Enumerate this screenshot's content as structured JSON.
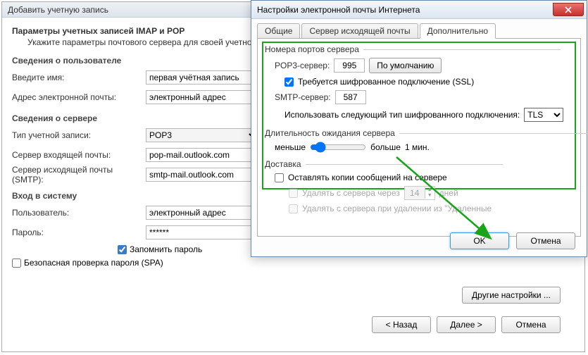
{
  "back": {
    "title": "Добавить учетную запись",
    "section_title": "Параметры учетных записей IMAP и POP",
    "section_desc": "Укажите параметры почтового сервера для своей учетно",
    "user_group": "Сведения о пользователе",
    "name_label": "Введите имя:",
    "name_value": "первая учётная запись",
    "email_label": "Адрес электронной почты:",
    "email_value": "электронный адрес",
    "server_group": "Сведения о сервере",
    "acct_type_label": "Тип учетной записи:",
    "acct_type_value": "POP3",
    "incoming_label": "Сервер входящей почты:",
    "incoming_value": "pop-mail.outlook.com",
    "outgoing_label": "Сервер исходящей почты (SMTP):",
    "outgoing_value": "smtp-mail.outlook.com",
    "login_group": "Вход в систему",
    "user_label": "Пользователь:",
    "user_value": "электронный адрес",
    "pass_label": "Пароль:",
    "pass_value": "******",
    "remember_label": "Запомнить пароль",
    "spa_label": "Безопасная проверка пароля (SPA)",
    "more_settings": "Другие настройки ...",
    "back_btn": "< Назад",
    "next_btn": "Далее >",
    "cancel_btn": "Отмена"
  },
  "front": {
    "title": "Настройки электронной почты Интернета",
    "tabs": {
      "general": "Общие",
      "outgoing": "Сервер исходящей почты",
      "advanced": "Дополнительно"
    },
    "ports_legend": "Номера портов сервера",
    "pop3_label": "POP3-сервер:",
    "pop3_value": "995",
    "default_btn": "По умолчанию",
    "ssl_label": "Требуется шифрованное подключение (SSL)",
    "smtp_label": "SMTP-сервер:",
    "smtp_value": "587",
    "enc_label": "Использовать следующий тип шифрованного подключения:",
    "enc_value": "TLS",
    "timeout_legend": "Длительность ожидания сервера",
    "less": "меньше",
    "more": "больше",
    "timeout_value": "1 мин.",
    "delivery_legend": "Доставка",
    "leave_copy": "Оставлять копии сообщений на сервере",
    "remove_after": "Удалять с сервера через",
    "remove_after_days": "14",
    "days_label": "дней",
    "remove_deleted": "Удалять с сервера при удалении из \"Удаленные",
    "ok": "OK",
    "cancel": "Отмена"
  }
}
